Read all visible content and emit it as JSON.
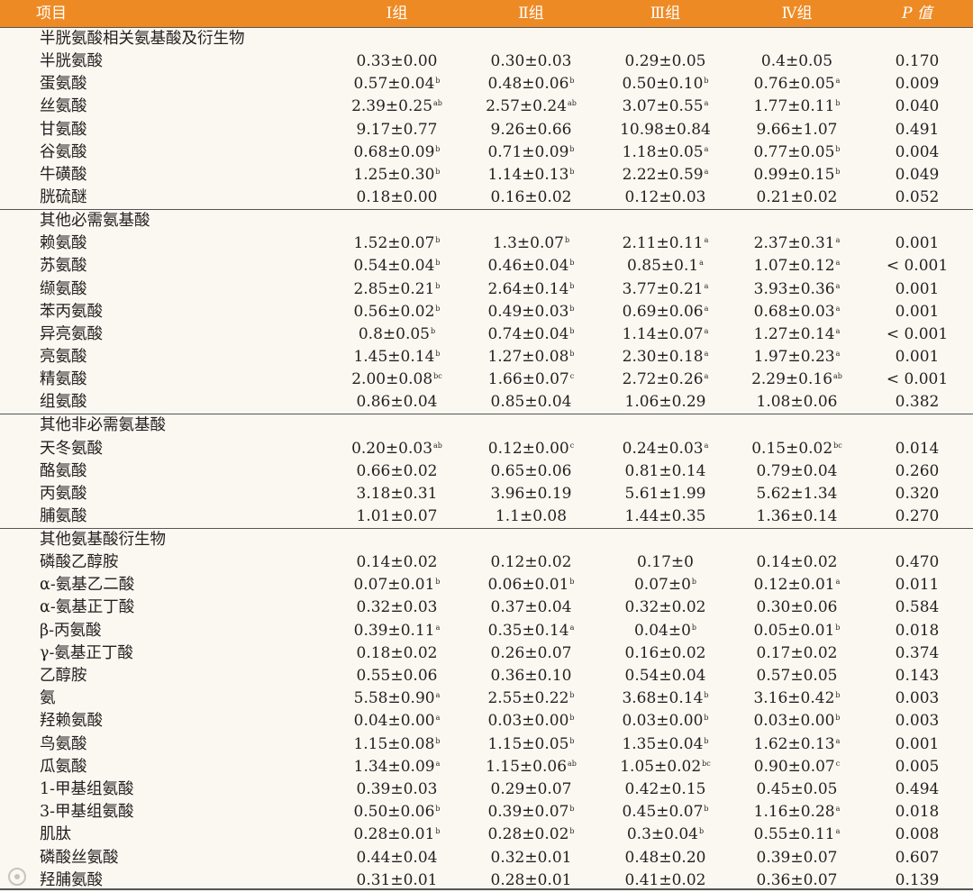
{
  "header": [
    "项目",
    "Ⅰ组",
    "Ⅱ组",
    "Ⅲ组",
    "Ⅳ组",
    "P 值"
  ],
  "sections": [
    {
      "title": "半胱氨酸相关氨基酸及衍生物",
      "rows": [
        {
          "name": "半胱氨酸",
          "v": [
            "0.33±0.00",
            "0.30±0.03",
            "0.29±0.05",
            "0.4±0.05",
            "0.170"
          ],
          "s": [
            "",
            "",
            "",
            "",
            ""
          ]
        },
        {
          "name": "蛋氨酸",
          "v": [
            "0.57±0.04",
            "0.48±0.06",
            "0.50±0.10",
            "0.76±0.05",
            "0.009"
          ],
          "s": [
            "b",
            "b",
            "b",
            "a",
            ""
          ]
        },
        {
          "name": "丝氨酸",
          "v": [
            "2.39±0.25",
            "2.57±0.24",
            "3.07±0.55",
            "1.77±0.11",
            "0.040"
          ],
          "s": [
            "ab",
            "ab",
            "a",
            "b",
            ""
          ]
        },
        {
          "name": "甘氨酸",
          "v": [
            "9.17±0.77",
            "9.26±0.66",
            "10.98±0.84",
            "9.66±1.07",
            "0.491"
          ],
          "s": [
            "",
            "",
            "",
            "",
            ""
          ]
        },
        {
          "name": "谷氨酸",
          "v": [
            "0.68±0.09",
            "0.71±0.09",
            "1.18±0.05",
            "0.77±0.05",
            "0.004"
          ],
          "s": [
            "b",
            "b",
            "a",
            "b",
            ""
          ]
        },
        {
          "name": "牛磺酸",
          "v": [
            "1.25±0.30",
            "1.14±0.13",
            "2.22±0.59",
            "0.99±0.15",
            "0.049"
          ],
          "s": [
            "b",
            "b",
            "a",
            "b",
            ""
          ]
        },
        {
          "name": "胱硫醚",
          "v": [
            "0.18±0.00",
            "0.16±0.02",
            "0.12±0.03",
            "0.21±0.02",
            "0.052"
          ],
          "s": [
            "",
            "",
            "",
            "",
            ""
          ]
        }
      ]
    },
    {
      "title": "其他必需氨基酸",
      "rows": [
        {
          "name": "赖氨酸",
          "v": [
            "1.52±0.07",
            "1.3±0.07",
            "2.11±0.11",
            "2.37±0.31",
            "0.001"
          ],
          "s": [
            "b",
            "b",
            "a",
            "a",
            ""
          ]
        },
        {
          "name": "苏氨酸",
          "v": [
            "0.54±0.04",
            "0.46±0.04",
            "0.85±0.1",
            "1.07±0.12",
            "< 0.001"
          ],
          "s": [
            "b",
            "b",
            "a",
            "a",
            ""
          ]
        },
        {
          "name": "缬氨酸",
          "v": [
            "2.85±0.21",
            "2.64±0.14",
            "3.77±0.21",
            "3.93±0.36",
            "0.001"
          ],
          "s": [
            "b",
            "b",
            "a",
            "a",
            ""
          ]
        },
        {
          "name": "苯丙氨酸",
          "v": [
            "0.56±0.02",
            "0.49±0.03",
            "0.69±0.06",
            "0.68±0.03",
            "0.001"
          ],
          "s": [
            "b",
            "b",
            "a",
            "a",
            ""
          ]
        },
        {
          "name": "异亮氨酸",
          "v": [
            "0.8±0.05",
            "0.74±0.04",
            "1.14±0.07",
            "1.27±0.14",
            "< 0.001"
          ],
          "s": [
            "b",
            "b",
            "a",
            "a",
            ""
          ]
        },
        {
          "name": "亮氨酸",
          "v": [
            "1.45±0.14",
            "1.27±0.08",
            "2.30±0.18",
            "1.97±0.23",
            "0.001"
          ],
          "s": [
            "b",
            "b",
            "a",
            "a",
            ""
          ]
        },
        {
          "name": "精氨酸",
          "v": [
            "2.00±0.08",
            "1.66±0.07",
            "2.72±0.26",
            "2.29±0.16",
            "< 0.001"
          ],
          "s": [
            "bc",
            "c",
            "a",
            "ab",
            ""
          ]
        },
        {
          "name": "组氨酸",
          "v": [
            "0.86±0.04",
            "0.85±0.04",
            "1.06±0.29",
            "1.08±0.06",
            "0.382"
          ],
          "s": [
            "",
            "",
            "",
            "",
            ""
          ]
        }
      ]
    },
    {
      "title": "其他非必需氨基酸",
      "rows": [
        {
          "name": "天冬氨酸",
          "v": [
            "0.20±0.03",
            "0.12±0.00",
            "0.24±0.03",
            "0.15±0.02",
            "0.014"
          ],
          "s": [
            "ab",
            "c",
            "a",
            "bc",
            ""
          ]
        },
        {
          "name": "酪氨酸",
          "v": [
            "0.66±0.02",
            "0.65±0.06",
            "0.81±0.14",
            "0.79±0.04",
            "0.260"
          ],
          "s": [
            "",
            "",
            "",
            "",
            ""
          ]
        },
        {
          "name": "丙氨酸",
          "v": [
            "3.18±0.31",
            "3.96±0.19",
            "5.61±1.99",
            "5.62±1.34",
            "0.320"
          ],
          "s": [
            "",
            "",
            "",
            "",
            ""
          ]
        },
        {
          "name": "脯氨酸",
          "v": [
            "1.01±0.07",
            "1.1±0.08",
            "1.44±0.35",
            "1.36±0.14",
            "0.270"
          ],
          "s": [
            "",
            "",
            "",
            "",
            ""
          ]
        }
      ]
    },
    {
      "title": "其他氨基酸衍生物",
      "rows": [
        {
          "name": "磷酸乙醇胺",
          "v": [
            "0.14±0.02",
            "0.12±0.02",
            "0.17±0",
            "0.14±0.02",
            "0.470"
          ],
          "s": [
            "",
            "",
            "",
            "",
            ""
          ]
        },
        {
          "name": "α-氨基乙二酸",
          "v": [
            "0.07±0.01",
            "0.06±0.01",
            "0.07±0",
            "0.12±0.01",
            "0.011"
          ],
          "s": [
            "b",
            "b",
            "b",
            "a",
            ""
          ]
        },
        {
          "name": "α-氨基正丁酸",
          "v": [
            "0.32±0.03",
            "0.37±0.04",
            "0.32±0.02",
            "0.30±0.06",
            "0.584"
          ],
          "s": [
            "",
            "",
            "",
            "",
            ""
          ]
        },
        {
          "name": "β-丙氨酸",
          "v": [
            "0.39±0.11",
            "0.35±0.14",
            "0.04±0",
            "0.05±0.01",
            "0.018"
          ],
          "s": [
            "a",
            "a",
            "b",
            "b",
            ""
          ]
        },
        {
          "name": "γ-氨基正丁酸",
          "v": [
            "0.18±0.02",
            "0.26±0.07",
            "0.16±0.02",
            "0.17±0.02",
            "0.374"
          ],
          "s": [
            "",
            "",
            "",
            "",
            ""
          ]
        },
        {
          "name": "乙醇胺",
          "v": [
            "0.55±0.06",
            "0.36±0.10",
            "0.54±0.04",
            "0.57±0.05",
            "0.143"
          ],
          "s": [
            "",
            "",
            "",
            "",
            ""
          ]
        },
        {
          "name": "氨",
          "v": [
            "5.58±0.90",
            "2.55±0.22",
            "3.68±0.14",
            "3.16±0.42",
            "0.003"
          ],
          "s": [
            "a",
            "b",
            "b",
            "b",
            ""
          ]
        },
        {
          "name": "羟赖氨酸",
          "v": [
            "0.04±0.00",
            "0.03±0.00",
            "0.03±0.00",
            "0.03±0.00",
            "0.003"
          ],
          "s": [
            "a",
            "b",
            "b",
            "b",
            ""
          ]
        },
        {
          "name": "鸟氨酸",
          "v": [
            "1.15±0.08",
            "1.15±0.05",
            "1.35±0.04",
            "1.62±0.13",
            "0.001"
          ],
          "s": [
            "b",
            "b",
            "b",
            "a",
            ""
          ]
        },
        {
          "name": "瓜氨酸",
          "v": [
            "1.34±0.09",
            "1.15±0.06",
            "1.05±0.02",
            "0.90±0.07",
            "0.005"
          ],
          "s": [
            "a",
            "ab",
            "bc",
            "c",
            ""
          ]
        },
        {
          "name": "1-甲基组氨酸",
          "v": [
            "0.39±0.03",
            "0.29±0.07",
            "0.42±0.15",
            "0.45±0.05",
            "0.494"
          ],
          "s": [
            "",
            "",
            "",
            "",
            ""
          ]
        },
        {
          "name": "3-甲基组氨酸",
          "v": [
            "0.50±0.06",
            "0.39±0.07",
            "0.45±0.07",
            "1.16±0.28",
            "0.018"
          ],
          "s": [
            "b",
            "b",
            "b",
            "a",
            ""
          ]
        },
        {
          "name": "肌肽",
          "v": [
            "0.28±0.01",
            "0.28±0.02",
            "0.3±0.04",
            "0.55±0.11",
            "0.008"
          ],
          "s": [
            "b",
            "b",
            "b",
            "a",
            ""
          ]
        },
        {
          "name": "磷酸丝氨酸",
          "v": [
            "0.44±0.04",
            "0.32±0.01",
            "0.48±0.20",
            "0.39±0.07",
            "0.607"
          ],
          "s": [
            "",
            "",
            "",
            "",
            ""
          ]
        },
        {
          "name": "羟脯氨酸",
          "v": [
            "0.31±0.01",
            "0.28±0.01",
            "0.41±0.02",
            "0.36±0.07",
            "0.139"
          ],
          "s": [
            "",
            "",
            "",
            "",
            ""
          ]
        }
      ]
    }
  ],
  "colors": {
    "header_bg": "#ee8a23",
    "header_text": "#ffffff",
    "page_bg": "#faf8f1",
    "text": "#231f20",
    "rule": "#555555"
  },
  "icons": {
    "watermark": "circle-logo-icon"
  }
}
